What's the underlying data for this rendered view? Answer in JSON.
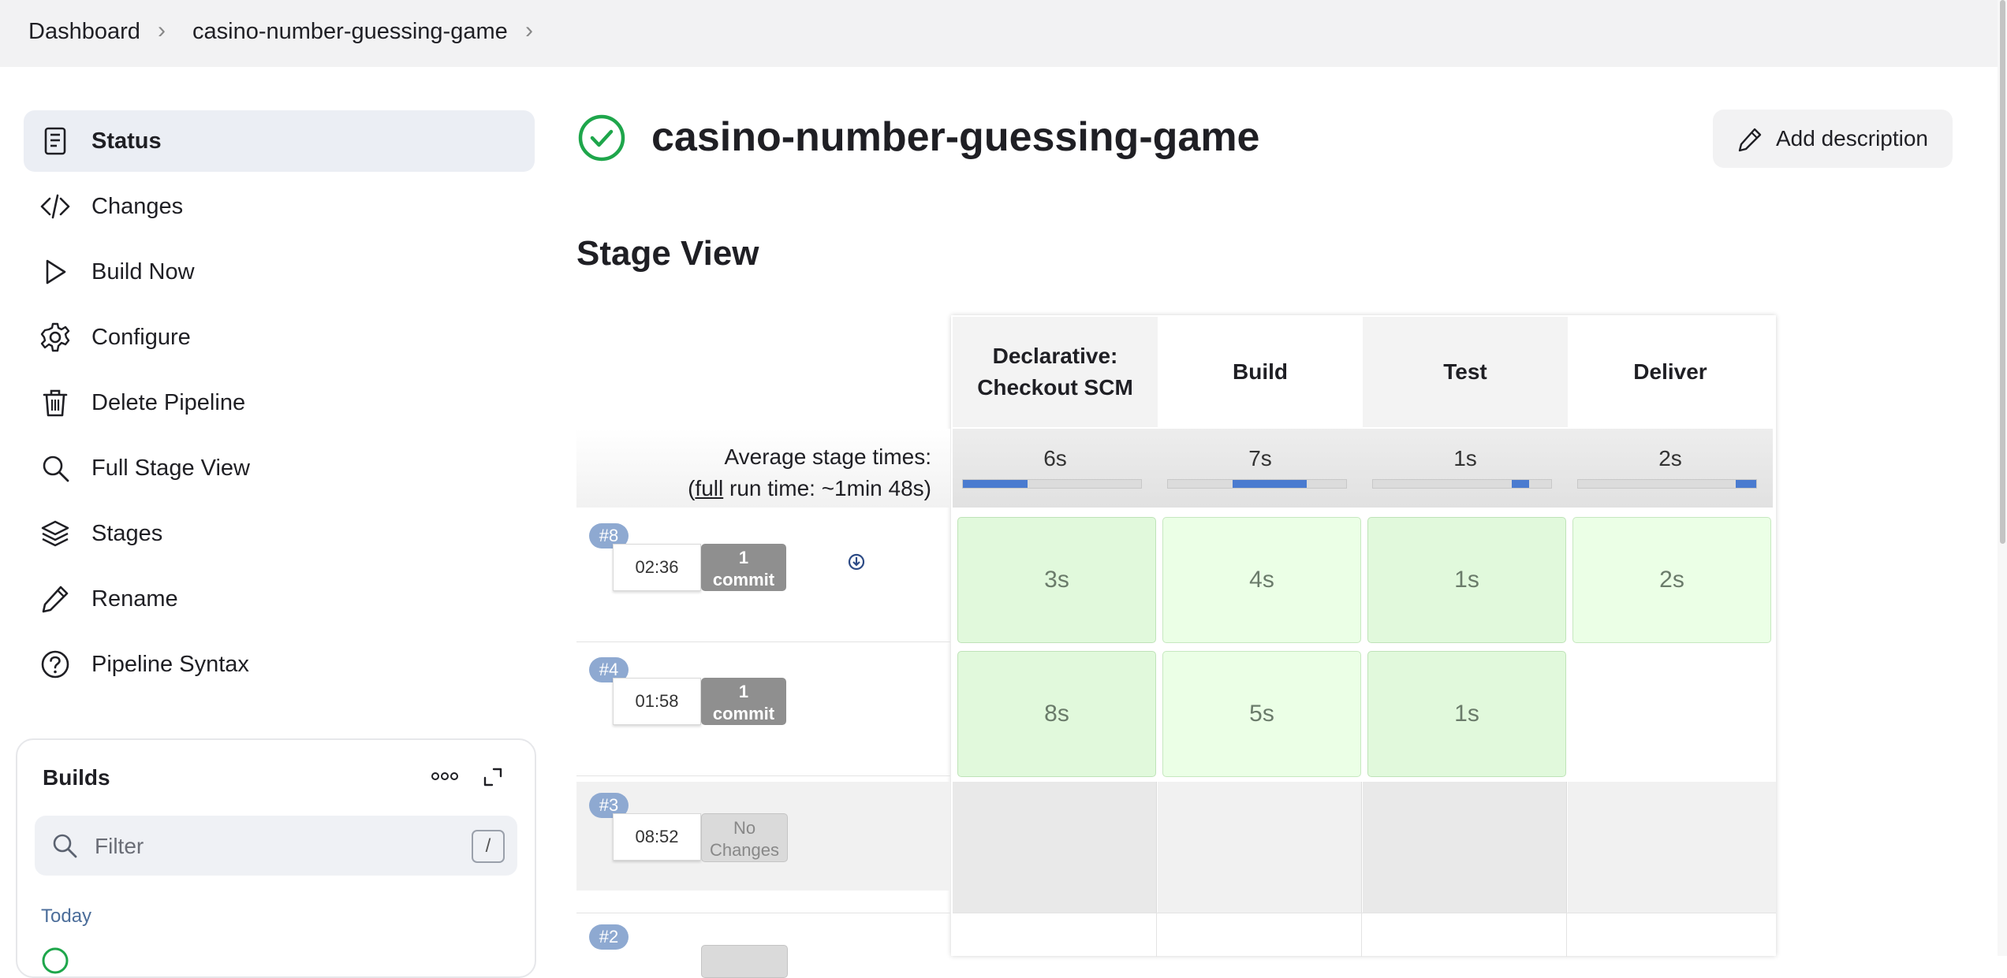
{
  "breadcrumb": {
    "items": [
      "Dashboard",
      "casino-number-guessing-game"
    ]
  },
  "sidebar": {
    "items": [
      {
        "label": "Status",
        "icon": "status-icon",
        "active": true
      },
      {
        "label": "Changes",
        "icon": "code-icon"
      },
      {
        "label": "Build Now",
        "icon": "play-icon"
      },
      {
        "label": "Configure",
        "icon": "gear-icon"
      },
      {
        "label": "Delete Pipeline",
        "icon": "trash-icon"
      },
      {
        "label": "Full Stage View",
        "icon": "search-icon"
      },
      {
        "label": "Stages",
        "icon": "layers-icon"
      },
      {
        "label": "Rename",
        "icon": "pencil-icon"
      },
      {
        "label": "Pipeline Syntax",
        "icon": "help-icon"
      }
    ]
  },
  "builds": {
    "title": "Builds",
    "filter_placeholder": "Filter",
    "filter_shortcut": "/",
    "group_label": "Today"
  },
  "main": {
    "title": "casino-number-guessing-game",
    "status": "success",
    "add_description_label": "Add description",
    "stage_view_title": "Stage View"
  },
  "stage_view": {
    "avg_label": "Average stage times:",
    "full_run_prefix": "(",
    "full_run_link": "full",
    "full_run_suffix": " run time: ~1min 48s)",
    "stages": [
      {
        "name_line1": "Declarative:",
        "name_line2": "Checkout SCM",
        "avg": "6s"
      },
      {
        "name_line1": "Build",
        "name_line2": "",
        "avg": "7s"
      },
      {
        "name_line1": "Test",
        "name_line2": "",
        "avg": "1s"
      },
      {
        "name_line1": "Deliver",
        "name_line2": "",
        "avg": "2s"
      }
    ],
    "runs": [
      {
        "id": "#8",
        "time": "02:36",
        "commit_line1": "1",
        "commit_line2": "commit",
        "cells": [
          "3s",
          "4s",
          "1s",
          "2s"
        ]
      },
      {
        "id": "#4",
        "time": "01:58",
        "commit_line1": "1",
        "commit_line2": "commit",
        "cells": [
          "8s",
          "5s",
          "1s",
          ""
        ]
      },
      {
        "id": "#3",
        "time": "08:52",
        "commit_line1": "No",
        "commit_line2": "Changes",
        "cells": [
          "",
          "",
          "",
          ""
        ]
      },
      {
        "id": "#2",
        "time": "",
        "commit_line1": "",
        "commit_line2": "",
        "cells": [
          "",
          "",
          "",
          ""
        ]
      }
    ]
  },
  "colors": {
    "success": "#1ea64b",
    "stage_success_bg": "#e1f9dc",
    "badge_bg": "#8ea9d1",
    "avg_bar_fill": "#4a7bd0"
  }
}
